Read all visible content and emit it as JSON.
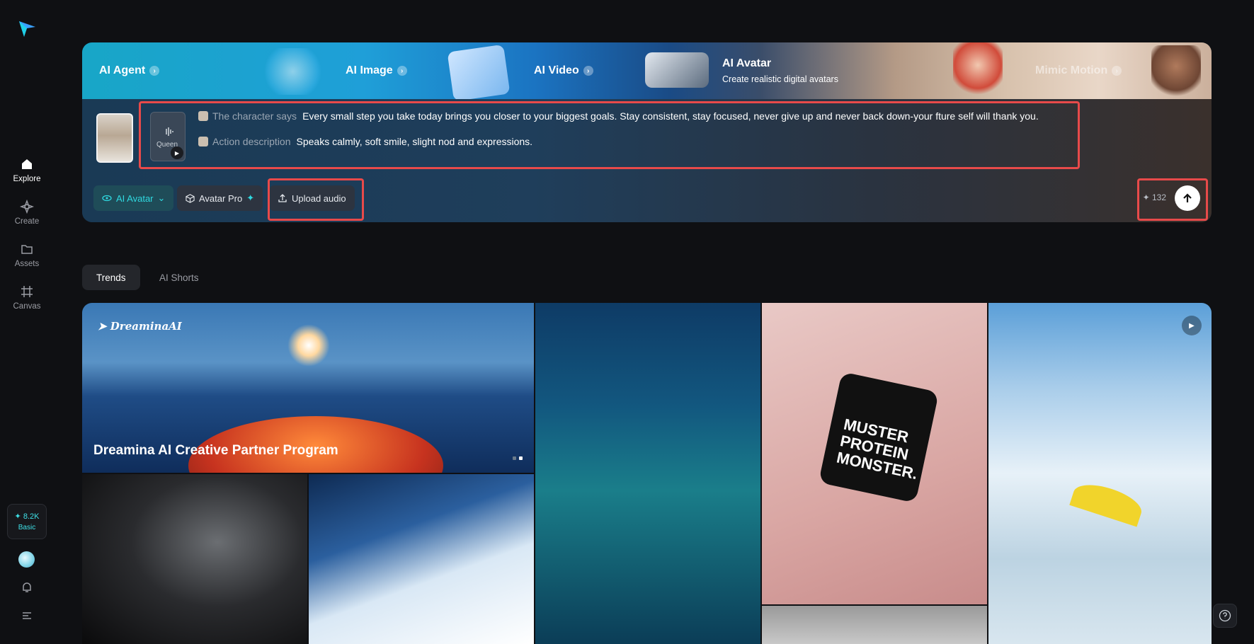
{
  "sidebar": {
    "nav": [
      {
        "label": "Explore",
        "icon": "home-icon",
        "active": true
      },
      {
        "label": "Create",
        "icon": "sparkle-icon",
        "active": false
      },
      {
        "label": "Assets",
        "icon": "folder-icon",
        "active": false
      },
      {
        "label": "Canvas",
        "icon": "frame-icon",
        "active": false
      }
    ],
    "credits": {
      "value": "8.2K",
      "plan": "Basic"
    }
  },
  "banner": {
    "tabs": [
      {
        "title": "AI Agent"
      },
      {
        "title": "AI Image"
      },
      {
        "title": "AI Video"
      },
      {
        "title": "AI Avatar",
        "subtitle": "Create realistic digital avatars"
      },
      {
        "title": "Mimic Motion"
      }
    ],
    "audio_card_label": "Queen",
    "prompt": {
      "character_says_label": "The character says",
      "character_says_text": "Every small step you take today brings you closer to your biggest goals. Stay consistent, stay focused, never give up and never back down-your fture self will thank you.",
      "action_label": "Action description",
      "action_text": "Speaks calmly, soft smile, slight nod and expressions."
    },
    "chips": {
      "mode": "AI Avatar",
      "model": "Avatar Pro",
      "upload": "Upload audio"
    },
    "cost": "132"
  },
  "feed": {
    "tabs": [
      "Trends",
      "AI Shorts"
    ],
    "hero": {
      "brand": "DreaminaAI",
      "title": "Dreamina AI Creative Partner Program"
    },
    "protein_text": "MUSTER PROTEIN MONSTER."
  },
  "colors": {
    "accent": "#2fd9e0",
    "highlight": "#e84a4a",
    "background": "#0f1013"
  }
}
